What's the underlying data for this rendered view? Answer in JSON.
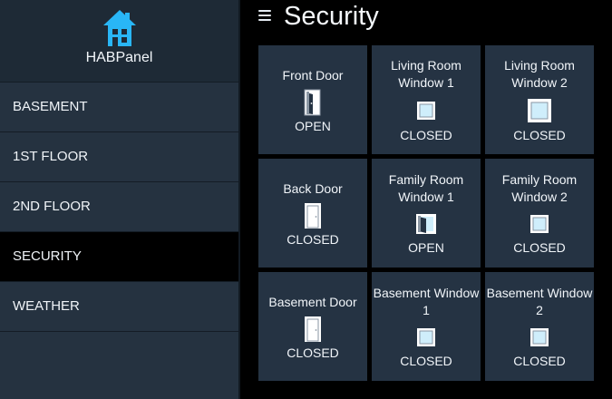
{
  "sidebar": {
    "brand_name": "HABPanel",
    "brand_icon": "home-icon",
    "brand_color": "#29b6f6",
    "items": [
      {
        "label": "BASEMENT",
        "active": false
      },
      {
        "label": "1ST FLOOR",
        "active": false
      },
      {
        "label": "2ND FLOOR",
        "active": false
      },
      {
        "label": "SECURITY",
        "active": true
      },
      {
        "label": "WEATHER",
        "active": false
      }
    ]
  },
  "header": {
    "menu_icon": "hamburger-icon",
    "title": "Security"
  },
  "tiles": [
    {
      "label": "Front Door",
      "icon": "door-open-icon",
      "state": "OPEN"
    },
    {
      "label": "Living Room Window 1",
      "icon": "window-closed-icon",
      "state": "CLOSED"
    },
    {
      "label": "Living Room Window 2",
      "icon": "window-closed-icon",
      "state": "CLOSED"
    },
    {
      "label": "Back Door",
      "icon": "door-closed-icon",
      "state": "CLOSED"
    },
    {
      "label": "Family Room Window 1",
      "icon": "window-open-icon",
      "state": "OPEN"
    },
    {
      "label": "Family Room Window 2",
      "icon": "window-closed-icon",
      "state": "CLOSED"
    },
    {
      "label": "Basement Door",
      "icon": "door-closed-icon",
      "state": "CLOSED"
    },
    {
      "label": "Basement Window 1",
      "icon": "window-closed-icon",
      "state": "CLOSED"
    },
    {
      "label": "Basement Window 2",
      "icon": "window-closed-icon",
      "state": "CLOSED"
    }
  ],
  "colors": {
    "tile_bg": "#253343",
    "sidebar_bg": "#253240",
    "active_item_bg": "#000000",
    "window_glass": "#cfeefb"
  }
}
